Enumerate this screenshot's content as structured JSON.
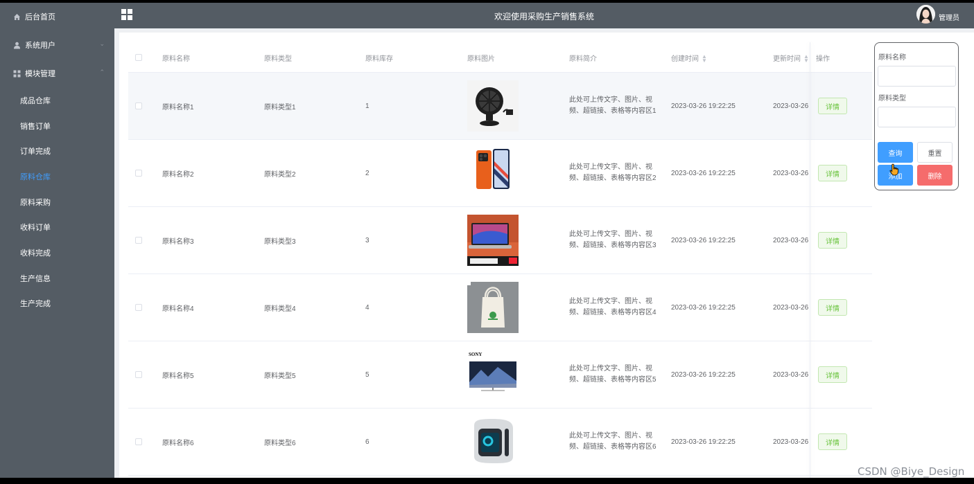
{
  "sidebar": {
    "items": [
      {
        "label": "后台首页",
        "icon": "home-icon"
      },
      {
        "label": "系统用户",
        "icon": "user-icon"
      },
      {
        "label": "模块管理",
        "icon": "grid-icon"
      }
    ],
    "subitems": [
      {
        "label": "成品仓库",
        "active": false
      },
      {
        "label": "销售订单",
        "active": false
      },
      {
        "label": "订单完成",
        "active": false
      },
      {
        "label": "原料仓库",
        "active": true
      },
      {
        "label": "原料采购",
        "active": false
      },
      {
        "label": "收料订单",
        "active": false
      },
      {
        "label": "收料完成",
        "active": false
      },
      {
        "label": "生产信息",
        "active": false
      },
      {
        "label": "生产完成",
        "active": false
      }
    ]
  },
  "header": {
    "title": "欢迎使用采购生产销售系统",
    "user": "管理员"
  },
  "table": {
    "columns": [
      "原料名称",
      "原料类型",
      "原料库存",
      "原料图片",
      "原料简介",
      "创建时间",
      "更新时间",
      "操作"
    ],
    "detail_label": "详情",
    "rows": [
      {
        "name": "原料名称1",
        "type": "原料类型1",
        "stock": "1",
        "desc": "此处可上传文字、图片、视频、超链接、表格等内容区1",
        "created": "2023-03-26 19:22:25",
        "updated": "2023-03-26",
        "image": "desk-fan"
      },
      {
        "name": "原料名称2",
        "type": "原料类型2",
        "stock": "2",
        "desc": "此处可上传文字、图片、视频、超链接、表格等内容区2",
        "created": "2023-03-26 19:22:25",
        "updated": "2023-03-26",
        "image": "phone"
      },
      {
        "name": "原料名称3",
        "type": "原料类型3",
        "stock": "3",
        "desc": "此处可上传文字、图片、视频、超链接、表格等内容区3",
        "created": "2023-03-26 19:22:25",
        "updated": "2023-03-26",
        "image": "laptop"
      },
      {
        "name": "原料名称4",
        "type": "原料类型4",
        "stock": "4",
        "desc": "此处可上传文字、图片、视频、超链接、表格等内容区4",
        "created": "2023-03-26 19:22:25",
        "updated": "2023-03-26",
        "image": "tote-bag"
      },
      {
        "name": "原料名称5",
        "type": "原料类型5",
        "stock": "5",
        "desc": "此处可上传文字、图片、视频、超链接、表格等内容区5",
        "created": "2023-03-26 19:22:25",
        "updated": "2023-03-26",
        "image": "sony-tv"
      },
      {
        "name": "原料名称6",
        "type": "原料类型6",
        "stock": "6",
        "desc": "此处可上传文字、图片、视频、超链接、表格等内容区6",
        "created": "2023-03-26 19:22:25",
        "updated": "2023-03-26",
        "image": "desktop-pc"
      }
    ]
  },
  "search": {
    "name_label": "原料名称",
    "type_label": "原料类型",
    "query": "查询",
    "reset": "重置",
    "add": "添加",
    "delete": "删除"
  },
  "images": {
    "tv_brand": "SONY"
  },
  "watermark": "CSDN @Biye_Design",
  "colors": {
    "sidebar_bg": "#545c64",
    "active_menu": "#409eff",
    "primary": "#409eff",
    "danger": "#f56c6c",
    "success": "#67c23a"
  }
}
